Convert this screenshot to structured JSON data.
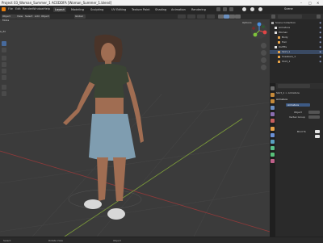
{
  "window": {
    "title": "Project 03_Woman_Summer_1 ACEDDFA [Woman_Summer_1.blend]",
    "controls": [
      "–",
      "□",
      "✕"
    ]
  },
  "menubar": {
    "items": [
      "File",
      "Edit",
      "Render",
      "Window",
      "Help"
    ],
    "workspaces": [
      "Layout",
      "Modeling",
      "Sculpting",
      "UV Editing",
      "Texture Paint",
      "Shading",
      "Animation",
      "Rendering"
    ],
    "active_workspace": "Layout",
    "right_label": "Scene"
  },
  "viewport": {
    "header": {
      "mode": "Object Mode",
      "view": "View",
      "select": "Select",
      "add": "Add",
      "object": "Object",
      "orientation": "Global"
    },
    "overlay_label": "Options",
    "corner_label": "e_do",
    "colors": {
      "background": "#3b3b3b",
      "grid": "#4a4a4a",
      "x_axis": "#8c3a3a",
      "y_axis": "#7b9a3a"
    }
  },
  "outliner": {
    "title": "Scene Collection",
    "rows": [
      {
        "label": "Scene Collection",
        "indent": 0,
        "selected": false
      },
      {
        "label": "Armature",
        "indent": 1,
        "selected": false
      },
      {
        "label": "Woman",
        "indent": 1,
        "selected": false
      },
      {
        "label": "Body",
        "indent": 2,
        "selected": false
      },
      {
        "label": "Hair",
        "indent": 2,
        "selected": false
      },
      {
        "label": "Outfits",
        "indent": 1,
        "selected": false
      },
      {
        "label": "Skirt_1",
        "indent": 2,
        "selected": true
      },
      {
        "label": "Sneakers_1",
        "indent": 2,
        "selected": false
      },
      {
        "label": "Shirt_1",
        "indent": 2,
        "selected": false
      }
    ]
  },
  "properties": {
    "breadcrumb": "Skirt_1 > Armature",
    "section": "Armature",
    "object_field": "Armature",
    "rows": [
      "Object",
      "Vertex Group",
      "Bind To"
    ]
  },
  "statusbar": {
    "left": "Select",
    "middle": "Rotate View",
    "right": "Object"
  }
}
